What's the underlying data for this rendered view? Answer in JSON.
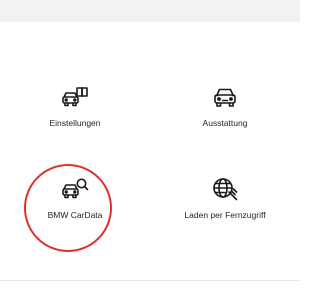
{
  "menu": {
    "items": [
      {
        "label": "Einstellungen",
        "icon": "car-settings-icon"
      },
      {
        "label": "Ausstattung",
        "icon": "car-front-icon"
      },
      {
        "label": "BMW CarData",
        "icon": "car-data-search-icon"
      },
      {
        "label": "Laden per Fernzugriff",
        "icon": "globe-plug-icon"
      }
    ]
  },
  "colors": {
    "background": "#ffffff",
    "top_bar": "#f2f2f2",
    "text": "#262626",
    "highlight": "#e0302a"
  }
}
